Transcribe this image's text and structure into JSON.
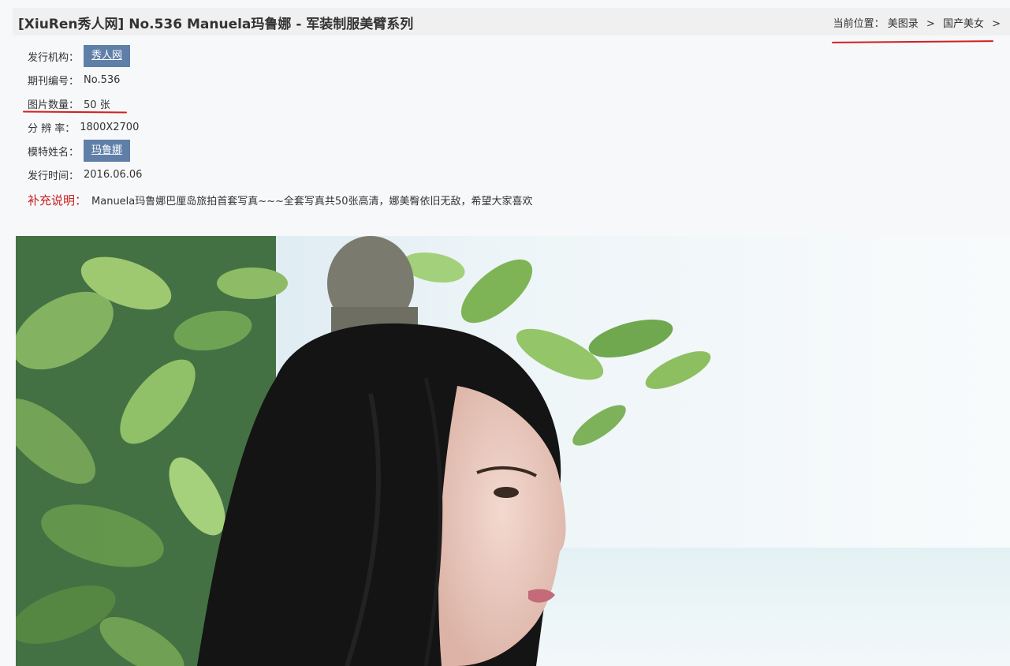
{
  "header": {
    "title": "[XiuRen秀人网] No.536 Manuela玛鲁娜 - 军装制服美臂系列",
    "breadcrumb_label": "当前位置：",
    "breadcrumb_items": [
      "美图录",
      "国产美女"
    ],
    "breadcrumb_sep": ">"
  },
  "info": {
    "publisher_label": "发行机构：",
    "publisher": "秀人网",
    "issue_label": "期刊编号：",
    "issue": "No.536",
    "count_label": "图片数量：",
    "count": "50 张",
    "resolution_label": "分 辨 率：",
    "resolution": "1800X2700",
    "model_label": "模特姓名：",
    "model": "玛鲁娜",
    "date_label": "发行时间：",
    "date": "2016.06.06",
    "note_label": "补充说明：",
    "note": "Manuela玛鲁娜巴厘岛旅拍首套写真~~~全套写真共50张高清，娜美臀依旧无敌，希望大家喜欢"
  },
  "colors": {
    "tag_bg": "#5f7fa8",
    "note_label": "#c81f1f",
    "annotation_red": "#d21f1f"
  }
}
